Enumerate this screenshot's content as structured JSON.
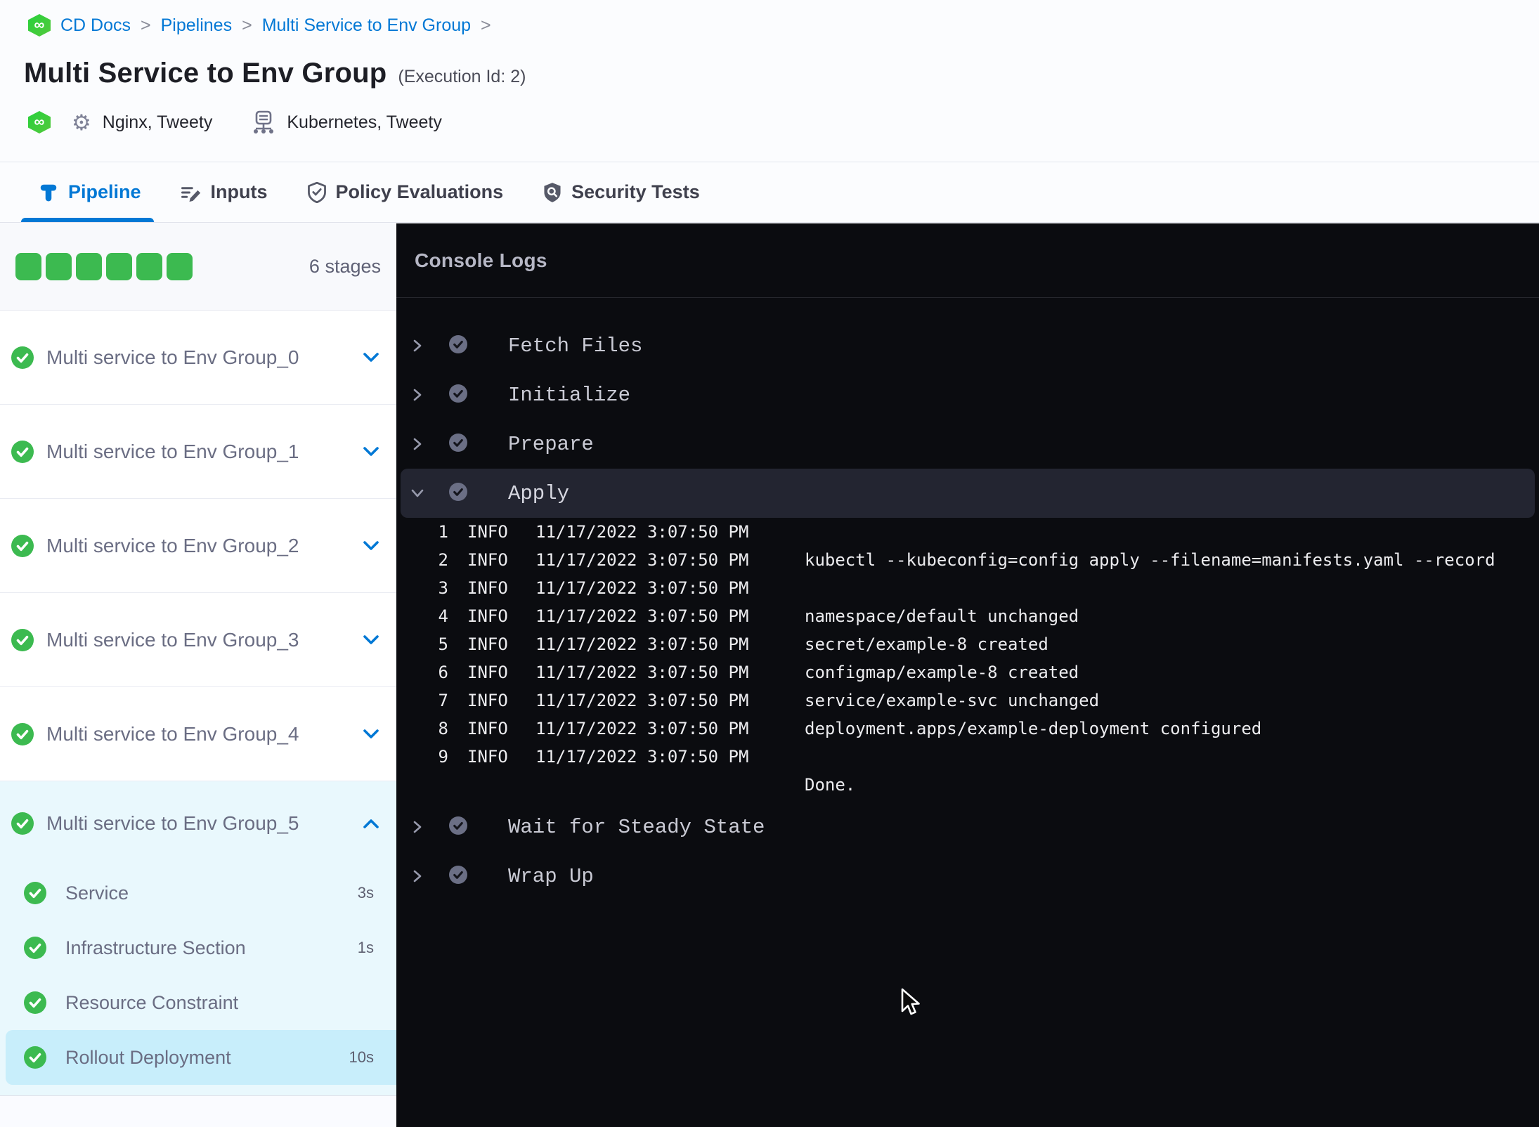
{
  "breadcrumb": {
    "items": [
      "CD Docs",
      "Pipelines",
      "Multi Service to Env Group"
    ],
    "separator": ">",
    "trailing_separator": ">"
  },
  "header": {
    "title": "Multi Service to Env Group",
    "execution_id": "(Execution Id: 2)",
    "services": "Nginx, Tweety",
    "infrastructure": "Kubernetes, Tweety"
  },
  "tabs": [
    {
      "label": "Pipeline",
      "icon": "pipeline-icon",
      "active": true
    },
    {
      "label": "Inputs",
      "icon": "inputs-icon",
      "active": false
    },
    {
      "label": "Policy Evaluations",
      "icon": "policy-shield-check-icon",
      "active": false
    },
    {
      "label": "Security Tests",
      "icon": "security-shield-icon",
      "active": false
    }
  ],
  "sidebar": {
    "stage_count_label": "6 stages",
    "stage_squares": 6,
    "stages": [
      {
        "label": "Multi service to Env Group_0",
        "status": "success",
        "expanded": false
      },
      {
        "label": "Multi service to Env Group_1",
        "status": "success",
        "expanded": false
      },
      {
        "label": "Multi service to Env Group_2",
        "status": "success",
        "expanded": false
      },
      {
        "label": "Multi service to Env Group_3",
        "status": "success",
        "expanded": false
      },
      {
        "label": "Multi service to Env Group_4",
        "status": "success",
        "expanded": false
      },
      {
        "label": "Multi service to Env Group_5",
        "status": "success",
        "expanded": true,
        "steps": [
          {
            "label": "Service",
            "duration": "3s",
            "status": "success",
            "selected": false
          },
          {
            "label": "Infrastructure Section",
            "duration": "1s",
            "status": "success",
            "selected": false
          },
          {
            "label": "Resource Constraint",
            "duration": "",
            "status": "success",
            "selected": false
          },
          {
            "label": "Rollout Deployment",
            "duration": "10s",
            "status": "success",
            "selected": true
          }
        ]
      }
    ]
  },
  "console": {
    "title": "Console Logs",
    "steps": [
      {
        "label": "Fetch Files",
        "status": "success",
        "expanded": false
      },
      {
        "label": "Initialize",
        "status": "success",
        "expanded": false
      },
      {
        "label": "Prepare",
        "status": "success",
        "expanded": false
      },
      {
        "label": "Apply",
        "status": "success",
        "expanded": true
      },
      {
        "label": "Wait for Steady State",
        "status": "success",
        "expanded": false
      },
      {
        "label": "Wrap Up",
        "status": "success",
        "expanded": false
      }
    ],
    "logs": [
      {
        "n": "1",
        "level": "INFO",
        "ts": "11/17/2022 3:07:50 PM",
        "msg": ""
      },
      {
        "n": "2",
        "level": "INFO",
        "ts": "11/17/2022 3:07:50 PM",
        "msg": "kubectl --kubeconfig=config apply --filename=manifests.yaml --record"
      },
      {
        "n": "3",
        "level": "INFO",
        "ts": "11/17/2022 3:07:50 PM",
        "msg": ""
      },
      {
        "n": "4",
        "level": "INFO",
        "ts": "11/17/2022 3:07:50 PM",
        "msg": "namespace/default unchanged"
      },
      {
        "n": "5",
        "level": "INFO",
        "ts": "11/17/2022 3:07:50 PM",
        "msg": "secret/example-8 created"
      },
      {
        "n": "6",
        "level": "INFO",
        "ts": "11/17/2022 3:07:50 PM",
        "msg": "configmap/example-8 created"
      },
      {
        "n": "7",
        "level": "INFO",
        "ts": "11/17/2022 3:07:50 PM",
        "msg": "service/example-svc unchanged"
      },
      {
        "n": "8",
        "level": "INFO",
        "ts": "11/17/2022 3:07:50 PM",
        "msg": "deployment.apps/example-deployment configured"
      },
      {
        "n": "9",
        "level": "INFO",
        "ts": "11/17/2022 3:07:50 PM",
        "msg": ""
      },
      {
        "n": "",
        "level": "",
        "ts": "",
        "msg": "Done."
      }
    ]
  },
  "colors": {
    "accent_blue": "#0278d5",
    "success_green": "#3cba50",
    "selected_row_blue": "#c8eefb",
    "expanded_stage_bg": "#e9f8fd",
    "console_bg": "#0b0c10",
    "expanded_step_bg": "#232531"
  }
}
